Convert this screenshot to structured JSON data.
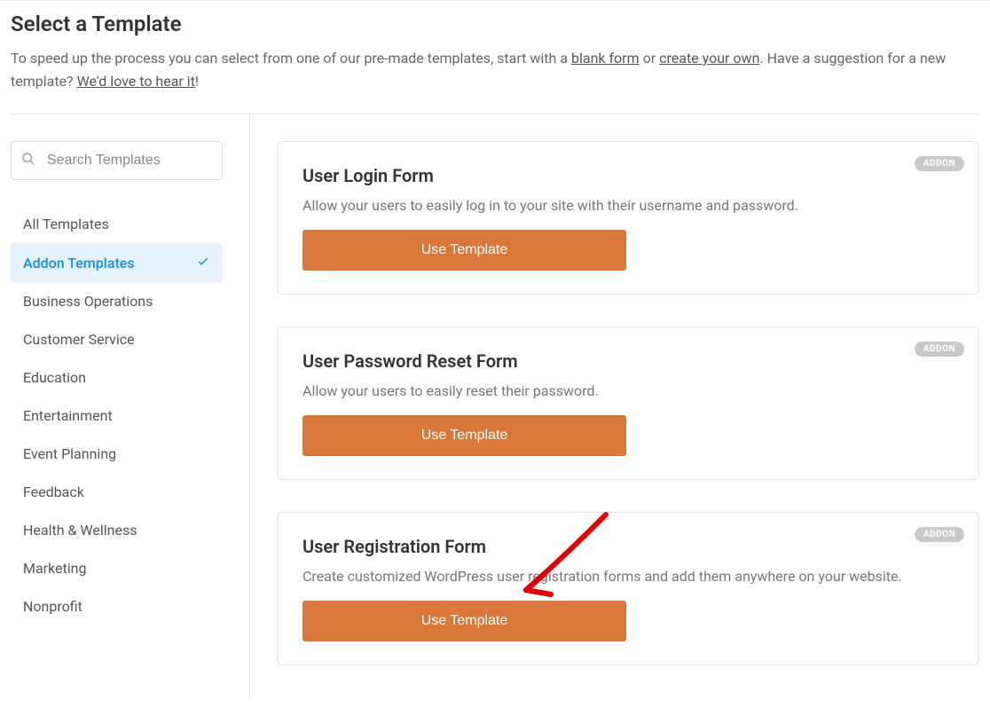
{
  "header": {
    "title": "Select a Template",
    "intro_prefix": "To speed up the process you can select from one of our pre-made templates, start with a ",
    "link_blank": "blank form",
    "intro_mid": " or ",
    "link_create": "create your own",
    "intro_suffix": ". Have a suggestion for a new template? ",
    "link_hear": "We'd love to hear it",
    "intro_end": "!"
  },
  "search": {
    "placeholder": "Search Templates"
  },
  "categories": [
    {
      "label": "All Templates",
      "active": false
    },
    {
      "label": "Addon Templates",
      "active": true
    },
    {
      "label": "Business Operations",
      "active": false
    },
    {
      "label": "Customer Service",
      "active": false
    },
    {
      "label": "Education",
      "active": false
    },
    {
      "label": "Entertainment",
      "active": false
    },
    {
      "label": "Event Planning",
      "active": false
    },
    {
      "label": "Feedback",
      "active": false
    },
    {
      "label": "Health & Wellness",
      "active": false
    },
    {
      "label": "Marketing",
      "active": false
    },
    {
      "label": "Nonprofit",
      "active": false
    }
  ],
  "templates": [
    {
      "title": "User Login Form",
      "desc": "Allow your users to easily log in to your site with their username and password.",
      "button": "Use Template",
      "badge": "ADDON"
    },
    {
      "title": "User Password Reset Form",
      "desc": "Allow your users to easily reset their password.",
      "button": "Use Template",
      "badge": "ADDON"
    },
    {
      "title": "User Registration Form",
      "desc": "Create customized WordPress user registration forms and add them anywhere on your website.",
      "button": "Use Template",
      "badge": "ADDON"
    }
  ]
}
